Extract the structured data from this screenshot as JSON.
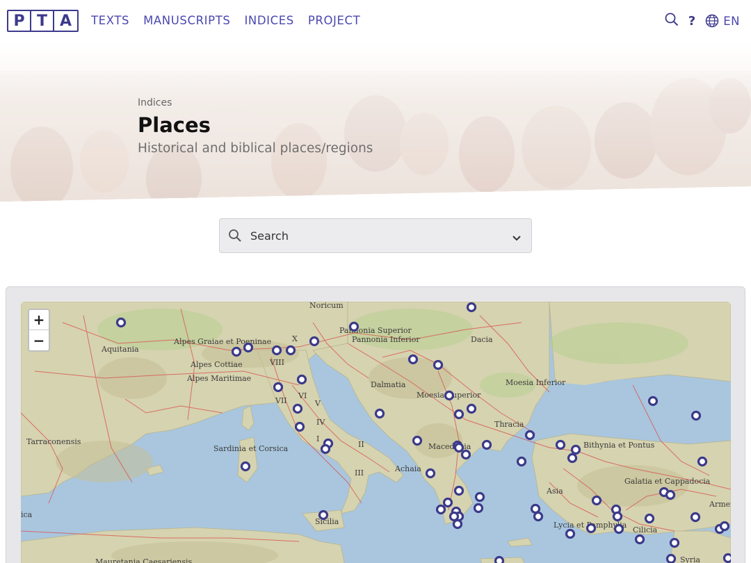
{
  "logo": {
    "letters": [
      "P",
      "T",
      "A"
    ]
  },
  "nav": {
    "links": [
      "TEXTS",
      "MANUSCRIPTS",
      "INDICES",
      "PROJECT"
    ],
    "help": "?",
    "language": "EN",
    "icons": [
      "search-icon",
      "help-icon",
      "globe-icon"
    ]
  },
  "hero": {
    "breadcrumb": "Indices",
    "title": "Places",
    "subtitle": "Historical and biblical places/regions"
  },
  "search": {
    "placeholder": "Search",
    "icons": [
      "search-icon",
      "chevron-down-icon"
    ]
  },
  "map": {
    "zoom_in": "+",
    "zoom_out": "−",
    "labels": [
      "Noricum",
      "Pannonia Superior",
      "Pannonia Inferior",
      "Dacia",
      "Aquitania",
      "Alpes Graiae et Poeninae",
      "X",
      "Alpes Cottiae",
      "VIII",
      "Alpes Maritimae",
      "Dalmatia",
      "Moesia Inferior",
      "Moesia Superior",
      "VII",
      "VI",
      "V",
      "IV",
      "Tarraconensis",
      "Sardinia et Corsica",
      "II",
      "I",
      "Thracia",
      "Macedonia",
      "Bithynia et Pontus",
      "III",
      "Achaia",
      "Galatia et Cappadocia",
      "Asia",
      "Armenia",
      "ica",
      "Sicilia",
      "Lycia et Pamphylia",
      "Cilicia",
      "Syria",
      "Mauretania Caesariensis"
    ]
  },
  "colors": {
    "brand": "#3d3a8c",
    "nav_link": "#4a47b0",
    "marker": "#3b3a8a",
    "sea": "#a9c6de",
    "land": "#d6d3b0",
    "road": "#d9534f"
  }
}
